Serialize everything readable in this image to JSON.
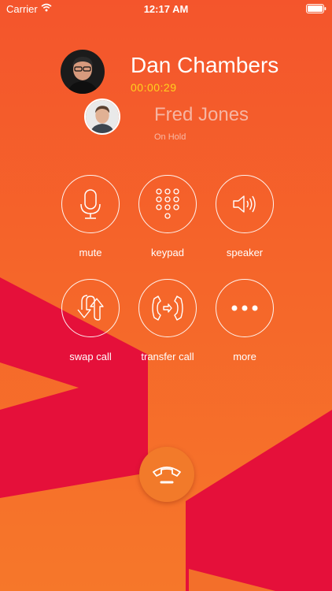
{
  "status_bar": {
    "carrier": "Carrier",
    "time": "12:17 AM",
    "wifi_icon": "wifi-icon",
    "battery_icon": "battery-icon"
  },
  "active_call": {
    "name": "Dan Chambers",
    "duration": "00:00:29"
  },
  "held_call": {
    "name": "Fred Jones",
    "status": "On Hold"
  },
  "controls": [
    {
      "label": "mute",
      "icon": "microphone-icon"
    },
    {
      "label": "keypad",
      "icon": "keypad-icon"
    },
    {
      "label": "speaker",
      "icon": "speaker-icon"
    },
    {
      "label": "swap call",
      "icon": "swap-icon"
    },
    {
      "label": "transfer call",
      "icon": "transfer-icon"
    },
    {
      "label": "more",
      "icon": "more-icon"
    }
  ],
  "end_call": {
    "icon": "hang-up-icon"
  },
  "colors": {
    "background_top": "#f4552c",
    "background_bottom": "#f6772a",
    "accent_shape": "#e5103a",
    "timer": "#ffd21e",
    "held_name": "#f6b5a2",
    "end_button": "#f27a2a"
  }
}
